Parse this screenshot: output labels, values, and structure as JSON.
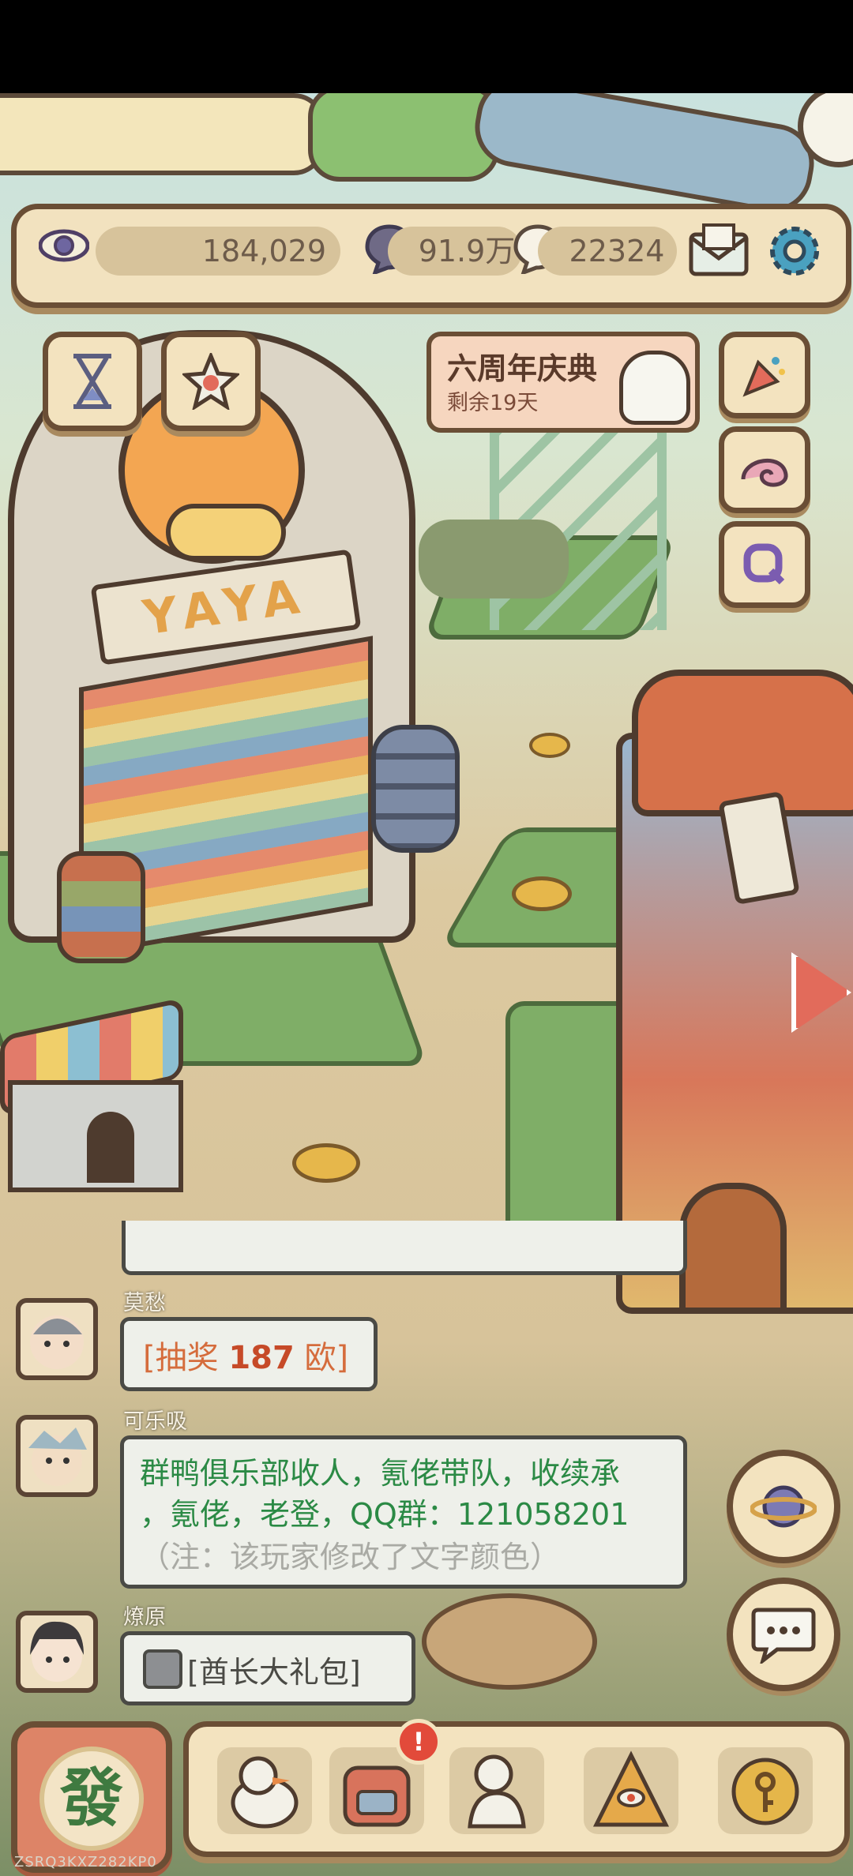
{
  "topbar": {
    "eye_value": "184,029",
    "coin_value": "91.9万",
    "duck_value": "22324"
  },
  "event_banner": {
    "title": "六周年庆典",
    "subtitle": "剩余19天"
  },
  "scene": {
    "sign_text": "YAYA"
  },
  "chat": {
    "messages": [
      {
        "user": "莫愁",
        "text_prefix": "[抽奖 ",
        "highlight": "187",
        "text_suffix": " 欧]"
      },
      {
        "user": "可乐吸",
        "line1": "群鸭俱乐部收人，氪佬带队，收续承",
        "line2": "，氪佬，老登，QQ群：121058201",
        "note": "（注：该玩家修改了文字颜色）"
      },
      {
        "user": "燎原",
        "text": "[酋长大礼包]"
      }
    ]
  },
  "bottom_nav": {
    "main_button_char": "發"
  },
  "watermark": "ZSRQ3KXZ282KP0",
  "colors": {
    "frame_brown": "#6a4e35",
    "panel_cream": "#f3e3bf",
    "lottery_orange": "#d56c3c",
    "custom_green": "#2b8a45",
    "note_gray": "#a9aaa4"
  }
}
